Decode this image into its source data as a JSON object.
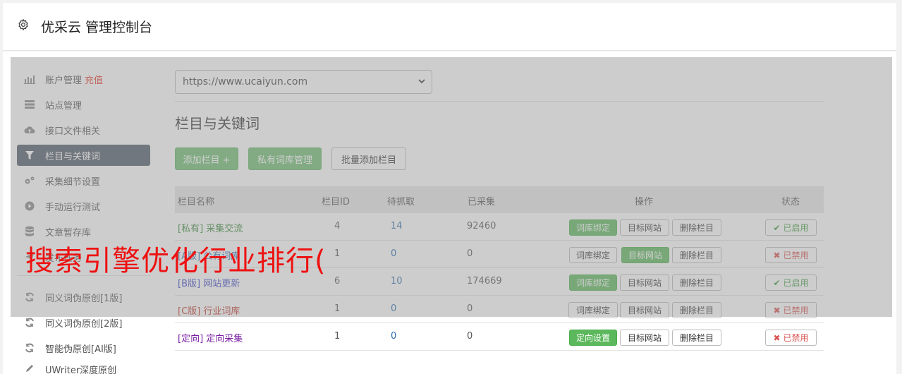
{
  "header": {
    "title": "优采云 管理控制台"
  },
  "sidebar": {
    "items": [
      {
        "label": "账户管理",
        "extra": "充值",
        "icon": "bar-chart-icon"
      },
      {
        "label": "站点管理",
        "icon": "server-icon"
      },
      {
        "label": "接口文件相关",
        "icon": "cloud-upload-icon"
      },
      {
        "label": "栏目与关键词",
        "icon": "filter-icon"
      },
      {
        "label": "采集细节设置",
        "icon": "gears-icon"
      },
      {
        "label": "手动运行测试",
        "icon": "play-circle-icon"
      },
      {
        "label": "文章暂存库",
        "icon": "database-icon"
      },
      {
        "label": "发布任务",
        "icon": "send-icon"
      },
      {
        "label": "同义词伪原创[1版]",
        "icon": "refresh-icon"
      },
      {
        "label": "同义词伪原创[2版]",
        "icon": "refresh-icon"
      },
      {
        "label": "智能伪原创[AI版]",
        "icon": "refresh-icon"
      },
      {
        "label": "UWriter深度原创",
        "icon": "edit-icon"
      }
    ]
  },
  "site_select": {
    "value": "https://www.ucaiyun.com"
  },
  "section": {
    "title": "栏目与关键词"
  },
  "toolbar": {
    "add_column": "添加栏目 +",
    "private_lib": "私有词库管理",
    "batch_add": "批量添加栏目"
  },
  "table": {
    "headers": {
      "name": "栏目名称",
      "id": "栏目ID",
      "wait": "待抓取",
      "done": "已采集",
      "ops": "操作",
      "status": "状态"
    },
    "rows": [
      {
        "tag": "[私有]",
        "name": "采集交流",
        "id": "4",
        "wait": "14",
        "done": "92460",
        "op1": "词库绑定",
        "op2": "目标网站",
        "op3": "删除栏目",
        "status": "已启用"
      },
      {
        "tag": "[A版]",
        "name": "公有词库",
        "id": "1",
        "wait": "0",
        "done": "0",
        "op1": "词库绑定",
        "op2": "目标网站",
        "op3": "删除栏目",
        "status": "已禁用"
      },
      {
        "tag": "[B版]",
        "name": "网站更新",
        "id": "6",
        "wait": "10",
        "done": "174669",
        "op1": "词库绑定",
        "op2": "目标网站",
        "op3": "删除栏目",
        "status": "已启用"
      },
      {
        "tag": "[C版]",
        "name": "行业词库",
        "id": "1",
        "wait": "0",
        "done": "0",
        "op1": "词库绑定",
        "op2": "目标网站",
        "op3": "删除栏目",
        "status": "已禁用"
      },
      {
        "tag": "[定向]",
        "name": "定向采集",
        "id": "1",
        "wait": "0",
        "done": "0",
        "op1": "定向设置",
        "op2": "目标网站",
        "op3": "删除栏目",
        "status": "已禁用"
      }
    ]
  },
  "overlay_text": "搜索引擎优化行业排行(",
  "colors": {
    "green": "#5cb85c",
    "sidebar_active": "#505a68",
    "recharge": "#e63b2e",
    "overlay_red": "#ee1111"
  }
}
